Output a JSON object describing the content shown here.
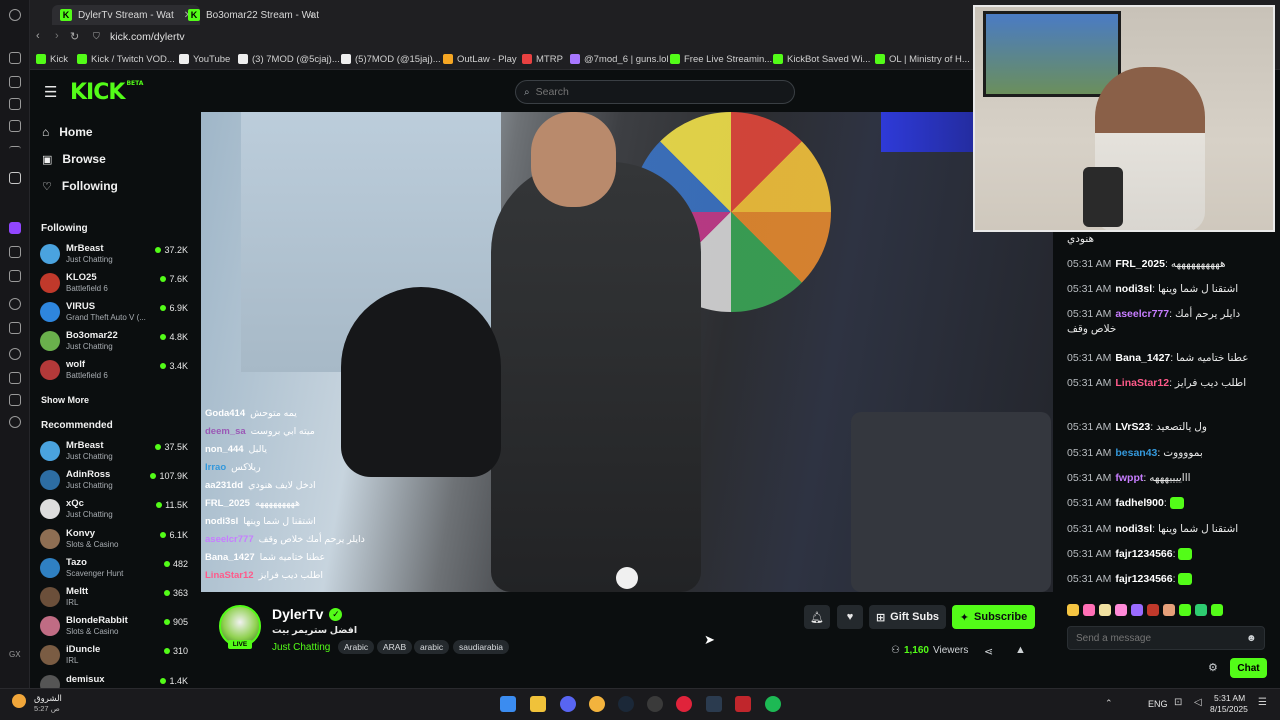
{
  "browser": {
    "tabs": [
      {
        "title": "DylerTv Stream - Wat",
        "active": true
      },
      {
        "title": "Bo3omar22 Stream - Wat",
        "active": false
      }
    ],
    "url": "kick.com/dylertv",
    "bookmarks": [
      {
        "label": "Kick",
        "color": "#53fc18"
      },
      {
        "label": "Kick / Twitch VOD...",
        "color": "#53fc18"
      },
      {
        "label": "YouTube",
        "color": "#eeeeee"
      },
      {
        "label": "(3) 7MOD (@5cjaj)...",
        "color": "#eeeeee"
      },
      {
        "label": "(5)7MOD (@15jaj)...",
        "color": "#eeeeee"
      },
      {
        "label": "OutLaw - Play",
        "color": "#f5a623"
      },
      {
        "label": "MTRP",
        "color": "#e84141"
      },
      {
        "label": "@7mod_6 | guns.lol",
        "color": "#a777ff"
      },
      {
        "label": "Free Live Streamin...",
        "color": "#53fc18"
      },
      {
        "label": "KickBot Saved Wi...",
        "color": "#53fc18"
      },
      {
        "label": "OL | Ministry of H...",
        "color": "#53fc18"
      }
    ]
  },
  "site": {
    "logo": "KICK",
    "logo_badge": "BETA",
    "search_placeholder": "Search"
  },
  "nav": {
    "home": "Home",
    "browse": "Browse",
    "following": "Following"
  },
  "following": {
    "title": "Following",
    "items": [
      {
        "name": "MrBeast",
        "category": "Just Chatting",
        "viewers": "37.2K",
        "color": "#4aa3df"
      },
      {
        "name": "KLO25",
        "category": "Battlefield 6",
        "viewers": "7.6K",
        "color": "#c0392b"
      },
      {
        "name": "VIRUS",
        "category": "Grand Theft Auto V (...",
        "viewers": "6.9K",
        "color": "#2e86de"
      },
      {
        "name": "Bo3omar22",
        "category": "Just Chatting",
        "viewers": "4.8K",
        "color": "#6ab04c"
      },
      {
        "name": "wolf",
        "category": "Battlefield 6",
        "viewers": "3.4K",
        "color": "#b33939"
      }
    ],
    "show_more": "Show More"
  },
  "recommended": {
    "title": "Recommended",
    "items": [
      {
        "name": "MrBeast",
        "category": "Just Chatting",
        "viewers": "37.5K",
        "color": "#4aa3df"
      },
      {
        "name": "AdinRoss",
        "category": "Just Chatting",
        "viewers": "107.9K",
        "color": "#2d6da3"
      },
      {
        "name": "xQc",
        "category": "Just Chatting",
        "viewers": "11.5K",
        "color": "#dddddd"
      },
      {
        "name": "Konvy",
        "category": "Slots & Casino",
        "viewers": "6.1K",
        "color": "#8e6e53"
      },
      {
        "name": "Tazo",
        "category": "Scavenger Hunt",
        "viewers": "482",
        "color": "#2f80c2"
      },
      {
        "name": "Meltt",
        "category": "IRL",
        "viewers": "363",
        "color": "#6b4f3a"
      },
      {
        "name": "BlondeRabbit",
        "category": "Slots & Casino",
        "viewers": "905",
        "color": "#c06c84"
      },
      {
        "name": "iDuncle",
        "category": "IRL",
        "viewers": "310",
        "color": "#7a5c43"
      },
      {
        "name": "demisux",
        "category": "",
        "viewers": "1.4K",
        "color": "#555555"
      }
    ]
  },
  "overlay_chat": [
    {
      "user": "Goda414",
      "msg": "يمه متوحش",
      "color": "#ffffff"
    },
    {
      "user": "deem_sa",
      "msg": "ميته ابي بروست",
      "color": "#9b59b6"
    },
    {
      "user": "non_444",
      "msg": "يالبل",
      "color": "#ffffff"
    },
    {
      "user": "Irrao",
      "msg": "ريلاكس",
      "color": "#3498db"
    },
    {
      "user": "aa231dd",
      "msg": "ادخل لايف هنودي",
      "color": "#ffffff"
    },
    {
      "user": "FRL_2025",
      "msg": "هههههههههه",
      "color": "#ffffff"
    },
    {
      "user": "nodi3sl",
      "msg": "اشتقنا ل شما وينها",
      "color": "#ffffff"
    },
    {
      "user": "aseelcr777",
      "msg": "دايلر يرحم أمك خلاص وقف",
      "color": "#c77dff"
    },
    {
      "user": "Bana_1427",
      "msg": "عطنا ختاميه شما",
      "color": "#ffffff"
    },
    {
      "user": "LinaStar12",
      "msg": "اطلب ديب فرايز",
      "color": "#ff5a8a"
    }
  ],
  "chat": {
    "messages": [
      {
        "time": "",
        "user": "",
        "msg": "هنودي",
        "color": "#ffffff"
      },
      {
        "time": "05:31 AM",
        "user": "FRL_2025",
        "msg": "ههههههههههه",
        "color": "#ffffff"
      },
      {
        "time": "05:31 AM",
        "user": "nodi3sl",
        "msg": "اشتقنا ل شما وينها",
        "color": "#ffffff"
      },
      {
        "time": "05:31 AM",
        "user": "aseelcr777",
        "msg": "دايلر يرحم أمك خلاص وقف",
        "color": "#c77dff"
      },
      {
        "time": "05:31 AM",
        "user": "Bana_1427",
        "msg": "عطنا ختاميه شما",
        "color": "#ffffff"
      },
      {
        "time": "05:31 AM",
        "user": "LinaStar12",
        "msg": "اطلب ديب فرايز",
        "color": "#ff5a8a"
      },
      {
        "time": "05:31 AM",
        "user": "LVrS23",
        "msg": "ول يالتصعيد",
        "color": "#ffffff"
      },
      {
        "time": "05:31 AM",
        "user": "besan43",
        "msg": "بمووووت",
        "color": "#3498db"
      },
      {
        "time": "05:31 AM",
        "user": "fwppt",
        "msg": "اااييييهههه",
        "color": "#c77dff"
      },
      {
        "time": "05:31 AM",
        "user": "fadhel900",
        "msg": "",
        "color": "#ffffff"
      },
      {
        "time": "05:31 AM",
        "user": "nodi3sl",
        "msg": "اشتقنا ل شما وينها",
        "color": "#ffffff"
      },
      {
        "time": "05:31 AM",
        "user": "fajr1234566",
        "msg": "",
        "color": "#ffffff"
      },
      {
        "time": "05:31 AM",
        "user": "fajr1234566",
        "msg": "",
        "color": "#ffffff"
      }
    ],
    "input_placeholder": "Send a message",
    "chat_button": "Chat"
  },
  "stream": {
    "streamer": "DylerTv",
    "title": "افضل ستريمر بيت",
    "live_badge": "LIVE",
    "category": "Just Chatting",
    "tags": [
      "Arabic",
      "ARAB",
      "arabic",
      "saudiarabia"
    ],
    "viewers": "1,160",
    "viewers_label": "Viewers",
    "gift_subs": "Gift Subs",
    "subscribe": "Subscribe"
  },
  "taskbar": {
    "weather": "الشروق",
    "weather_sub": "ص 5:27",
    "lang": "ENG",
    "time": "5:31 AM",
    "date": "8/15/2025"
  }
}
